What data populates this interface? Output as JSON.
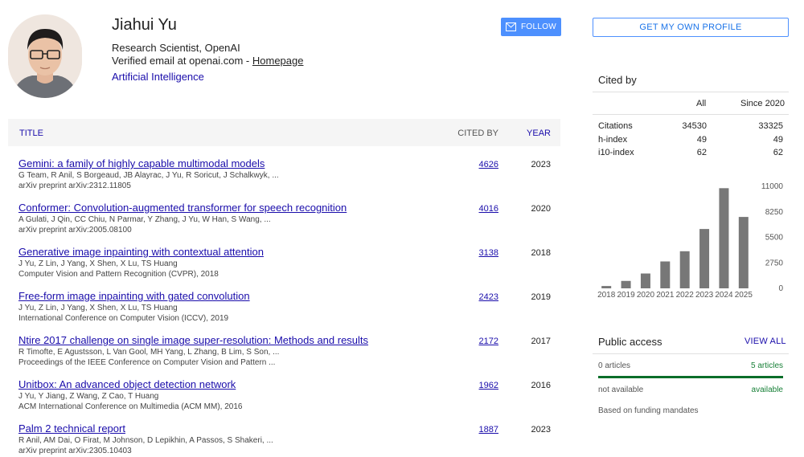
{
  "profile": {
    "name": "Jiahui Yu",
    "affiliation": "Research Scientist, OpenAI",
    "email_prefix": "Verified email at openai.com - ",
    "homepage_label": "Homepage",
    "interest": "Artificial Intelligence",
    "follow_label": "FOLLOW",
    "own_profile_label": "GET MY OWN PROFILE"
  },
  "table": {
    "col_title": "TITLE",
    "col_cited": "CITED BY",
    "col_year": "YEAR",
    "rows": [
      {
        "title": "Gemini: a family of highly capable multimodal models",
        "authors": "G Team, R Anil, S Borgeaud, JB Alayrac, J Yu, R Soricut, J Schalkwyk, ...",
        "venue": "arXiv preprint arXiv:2312.11805",
        "cited": "4626",
        "year": "2023"
      },
      {
        "title": "Conformer: Convolution-augmented transformer for speech recognition",
        "authors": "A Gulati, J Qin, CC Chiu, N Parmar, Y Zhang, J Yu, W Han, S Wang, ...",
        "venue": "arXiv preprint arXiv:2005.08100",
        "cited": "4016",
        "year": "2020"
      },
      {
        "title": "Generative image inpainting with contextual attention",
        "authors": "J Yu, Z Lin, J Yang, X Shen, X Lu, TS Huang",
        "venue": "Computer Vision and Pattern Recognition (CVPR), 2018",
        "cited": "3138",
        "year": "2018"
      },
      {
        "title": "Free-form image inpainting with gated convolution",
        "authors": "J Yu, Z Lin, J Yang, X Shen, X Lu, TS Huang",
        "venue": "International Conference on Computer Vision (ICCV), 2019",
        "cited": "2423",
        "year": "2019"
      },
      {
        "title": "Ntire 2017 challenge on single image super-resolution: Methods and results",
        "authors": "R Timofte, E Agustsson, L Van Gool, MH Yang, L Zhang, B Lim, S Son, ...",
        "venue": "Proceedings of the IEEE Conference on Computer Vision and Pattern ...",
        "cited": "2172",
        "year": "2017"
      },
      {
        "title": "Unitbox: An advanced object detection network",
        "authors": "J Yu, Y Jiang, Z Wang, Z Cao, T Huang",
        "venue": "ACM International Conference on Multimedia (ACM MM), 2016",
        "cited": "1962",
        "year": "2016"
      },
      {
        "title": "Palm 2 technical report",
        "authors": "R Anil, AM Dai, O Firat, M Johnson, D Lepikhin, A Passos, S Shakeri, ...",
        "venue": "arXiv preprint arXiv:2305.10403",
        "cited": "1887",
        "year": "2023"
      }
    ]
  },
  "cited_by": {
    "title": "Cited by",
    "col_all": "All",
    "col_since": "Since 2020",
    "rows": [
      {
        "label": "Citations",
        "all": "34530",
        "since": "33325"
      },
      {
        "label": "h-index",
        "all": "49",
        "since": "49"
      },
      {
        "label": "i10-index",
        "all": "62",
        "since": "62"
      }
    ]
  },
  "chart_data": {
    "type": "bar",
    "categories": [
      "2018",
      "2019",
      "2020",
      "2021",
      "2022",
      "2023",
      "2024",
      "2025"
    ],
    "values": [
      250,
      800,
      1600,
      2900,
      4000,
      6400,
      10800,
      7700
    ],
    "yticks": [
      "11000",
      "8250",
      "5500",
      "2750",
      "0"
    ],
    "ylim": [
      0,
      11000
    ],
    "bar_color": "#777777",
    "grid": false
  },
  "public_access": {
    "title": "Public access",
    "view_all": "VIEW ALL",
    "unavailable_count": "0 articles",
    "available_count": "5 articles",
    "unavailable_label": "not available",
    "available_label": "available",
    "available_fraction": 1.0,
    "mandates": "Based on funding mandates",
    "bar_color": "#0a6e2a"
  },
  "colors": {
    "link": "#1a0dab",
    "accent": "#4d90fe",
    "available": "#188038"
  }
}
